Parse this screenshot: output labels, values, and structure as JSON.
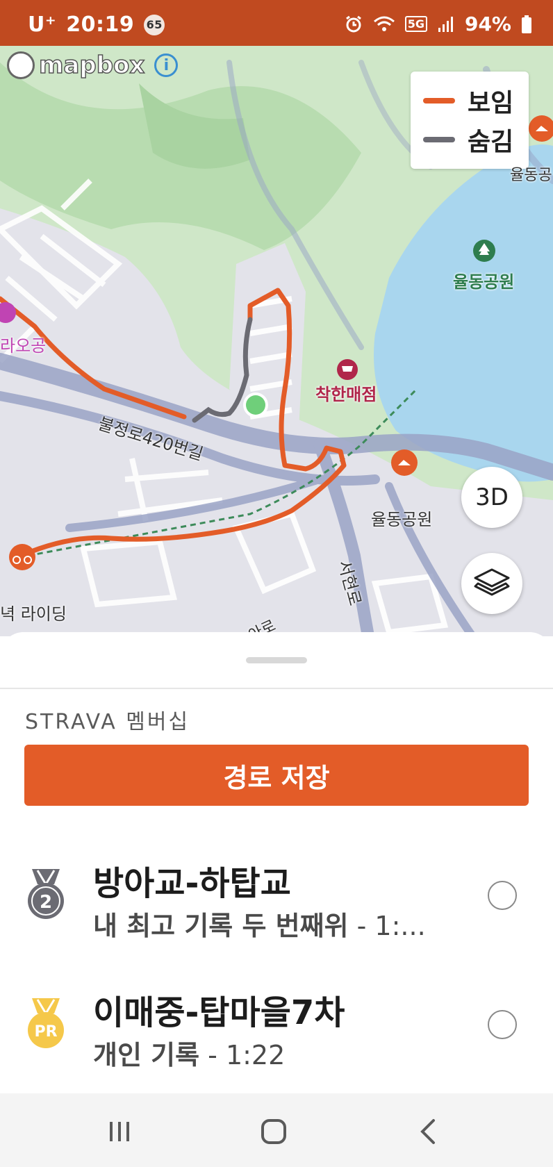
{
  "status_bar": {
    "carrier": "U⁺",
    "time": "20:19",
    "notification_count": "65",
    "network": "5G",
    "battery": "94%"
  },
  "map": {
    "attribution": "mapbox",
    "legend": {
      "shown_label": "보임",
      "hidden_label": "숨김",
      "shown_color": "#e35c28",
      "hidden_color": "#6b6b73"
    },
    "labels": {
      "road_bulgjeong": "불정로420번길",
      "store": "착한매점",
      "park_1": "율동공원",
      "park_2": "율동공원",
      "park_3": "율동공",
      "road_seohyeon": "서현로",
      "partial_left": "라오공",
      "riding": "녁 라이딩",
      "road_small": "아로"
    },
    "btn_3d": "3D",
    "layers_icon": "layers-icon"
  },
  "sheet": {
    "membership_label": "STRAVA 멤버십",
    "save_button": "경로 저장",
    "segments": [
      {
        "title": "방아교-하탑교",
        "achievement": "내 최고 기록 두 번째위",
        "time": " - 1:...",
        "medal": "2"
      },
      {
        "title": "이매중-탑마을7차",
        "achievement": "개인 기록",
        "time": " - 1:22",
        "medal": "PR"
      }
    ]
  },
  "colors": {
    "accent": "#e35c28",
    "status_bar": "#c04a20",
    "water": "#a9d6ee",
    "park": "#cfe7c8"
  }
}
